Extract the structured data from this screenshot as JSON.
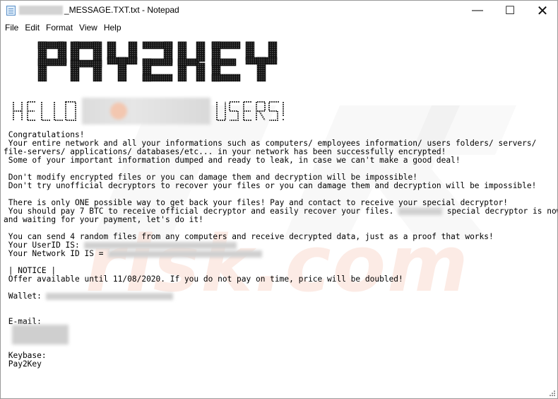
{
  "window": {
    "title": "_MESSAGE.TXT.txt - Notepad",
    "controls": {
      "minimize": "—",
      "maximize": "☐",
      "close": "✕"
    }
  },
  "menu": [
    "File",
    "Edit",
    "Format",
    "View",
    "Help"
  ],
  "note": {
    "logo_text": "PAY2KEY",
    "hello_left": "HELLO",
    "hello_right": "USERS!",
    "lines": {
      "l1": " Congratulations!",
      "l2": " Your entire network and all your informations such as computers/ employees information/ users folders/ servers/",
      "l3": "file-servers/ applications/ databases/etc... in your network has been successfully encrypted!",
      "l4": " Some of your important information dumped and ready to leak, in case we can't make a good deal!",
      "l5": " Don't modify encrypted files or you can damage them and decryption will be impossible!",
      "l6": " Don't try unofficial decryptors to recover your files or you can damage them and decryption will be impossible!",
      "l7": " There is only ONE possible way to get back your files! Pay and contact to receive your special decryptor!",
      "l8a": " You should pay 7 BTC to receive official decryptor and easily recover your files. ",
      "l8b": " special decryptor is now ready",
      "l9": "and waiting for your payment, let's do it!",
      "l10": " You can send 4 random files from any computers and receive decrypted data, just as a proof that works!",
      "l11": " Your UserID IS:",
      "l12": " Your Network ID IS = ",
      "l13": " | NOTICE |",
      "l14": " Offer available until 11/08/2020. If you do not pay on time, price will be doubled!",
      "l15": " Wallet:",
      "l16": " E-mail:",
      "l17": " Keybase:",
      "l18": " Pay2Key"
    }
  },
  "watermark": "risk.com"
}
